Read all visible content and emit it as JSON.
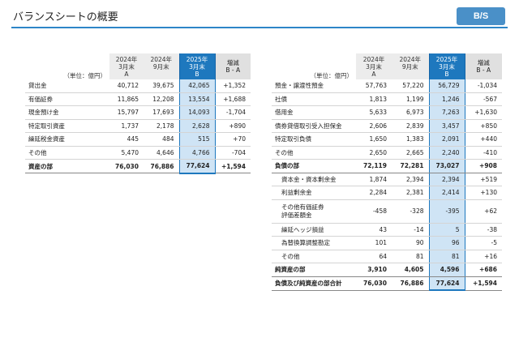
{
  "header": {
    "title": "バランスシートの概要",
    "badge": "B/S"
  },
  "columns": {
    "unit": "（単位：億円）",
    "c1": [
      "2024年",
      "3月末",
      "A"
    ],
    "c2": [
      "2024年",
      "9月末",
      ""
    ],
    "c3": [
      "2025年",
      "3月末",
      "B"
    ],
    "diff": [
      "増減",
      "B - A"
    ]
  },
  "assets": {
    "rows": [
      {
        "label": "貸出金",
        "a": "40,712",
        "m": "39,675",
        "b": "42,065",
        "d": "+1,352"
      },
      {
        "label": "有価証券",
        "a": "11,865",
        "m": "12,208",
        "b": "13,554",
        "d": "+1,688"
      },
      {
        "label": "現金預け金",
        "a": "15,797",
        "m": "17,693",
        "b": "14,093",
        "d": "-1,704"
      },
      {
        "label": "特定取引資産",
        "a": "1,737",
        "m": "2,178",
        "b": "2,628",
        "d": "+890"
      },
      {
        "label": "繰延税金資産",
        "a": "445",
        "m": "484",
        "b": "515",
        "d": "+70"
      },
      {
        "label": "その他",
        "a": "5,470",
        "m": "4,646",
        "b": "4,766",
        "d": "-704"
      }
    ],
    "total": {
      "label": "資産の部",
      "a": "76,030",
      "m": "76,886",
      "b": "77,624",
      "d": "+1,594"
    }
  },
  "liabilities": {
    "rows": [
      {
        "label": "預金・譲渡性預金",
        "a": "57,763",
        "m": "57,220",
        "b": "56,729",
        "d": "-1,034"
      },
      {
        "label": "社債",
        "a": "1,813",
        "m": "1,199",
        "b": "1,246",
        "d": "-567"
      },
      {
        "label": "借用金",
        "a": "5,633",
        "m": "6,973",
        "b": "7,263",
        "d": "+1,630"
      },
      {
        "label": "債券貸借取引受入担保金",
        "a": "2,606",
        "m": "2,839",
        "b": "3,457",
        "d": "+850"
      },
      {
        "label": "特定取引負債",
        "a": "1,650",
        "m": "1,383",
        "b": "2,091",
        "d": "+440"
      },
      {
        "label": "その他",
        "a": "2,650",
        "m": "2,665",
        "b": "2,240",
        "d": "-410"
      }
    ],
    "total": {
      "label": "負債の部",
      "a": "72,119",
      "m": "72,281",
      "b": "73,027",
      "d": "+908"
    }
  },
  "equity": {
    "rows": [
      {
        "label": "資本金・資本剰余金",
        "a": "1,874",
        "m": "2,394",
        "b": "2,394",
        "d": "+519"
      },
      {
        "label": "利益剰余金",
        "a": "2,284",
        "m": "2,381",
        "b": "2,414",
        "d": "+130"
      },
      {
        "label": "その他有価証券",
        "label2": "評価差額金",
        "a": "-458",
        "m": "-328",
        "b": "-395",
        "d": "+62"
      },
      {
        "label": "繰延ヘッジ損益",
        "a": "43",
        "m": "-14",
        "b": "5",
        "d": "-38"
      },
      {
        "label": "為替換算調整勘定",
        "a": "101",
        "m": "90",
        "b": "96",
        "d": "-5"
      },
      {
        "label": "その他",
        "a": "64",
        "m": "81",
        "b": "81",
        "d": "+16"
      }
    ],
    "total": {
      "label": "純資産の部",
      "a": "3,910",
      "m": "4,605",
      "b": "4,596",
      "d": "+686"
    },
    "grand": {
      "label": "負債及び純資産の部合計",
      "a": "76,030",
      "m": "76,886",
      "b": "77,624",
      "d": "+1,594"
    }
  }
}
